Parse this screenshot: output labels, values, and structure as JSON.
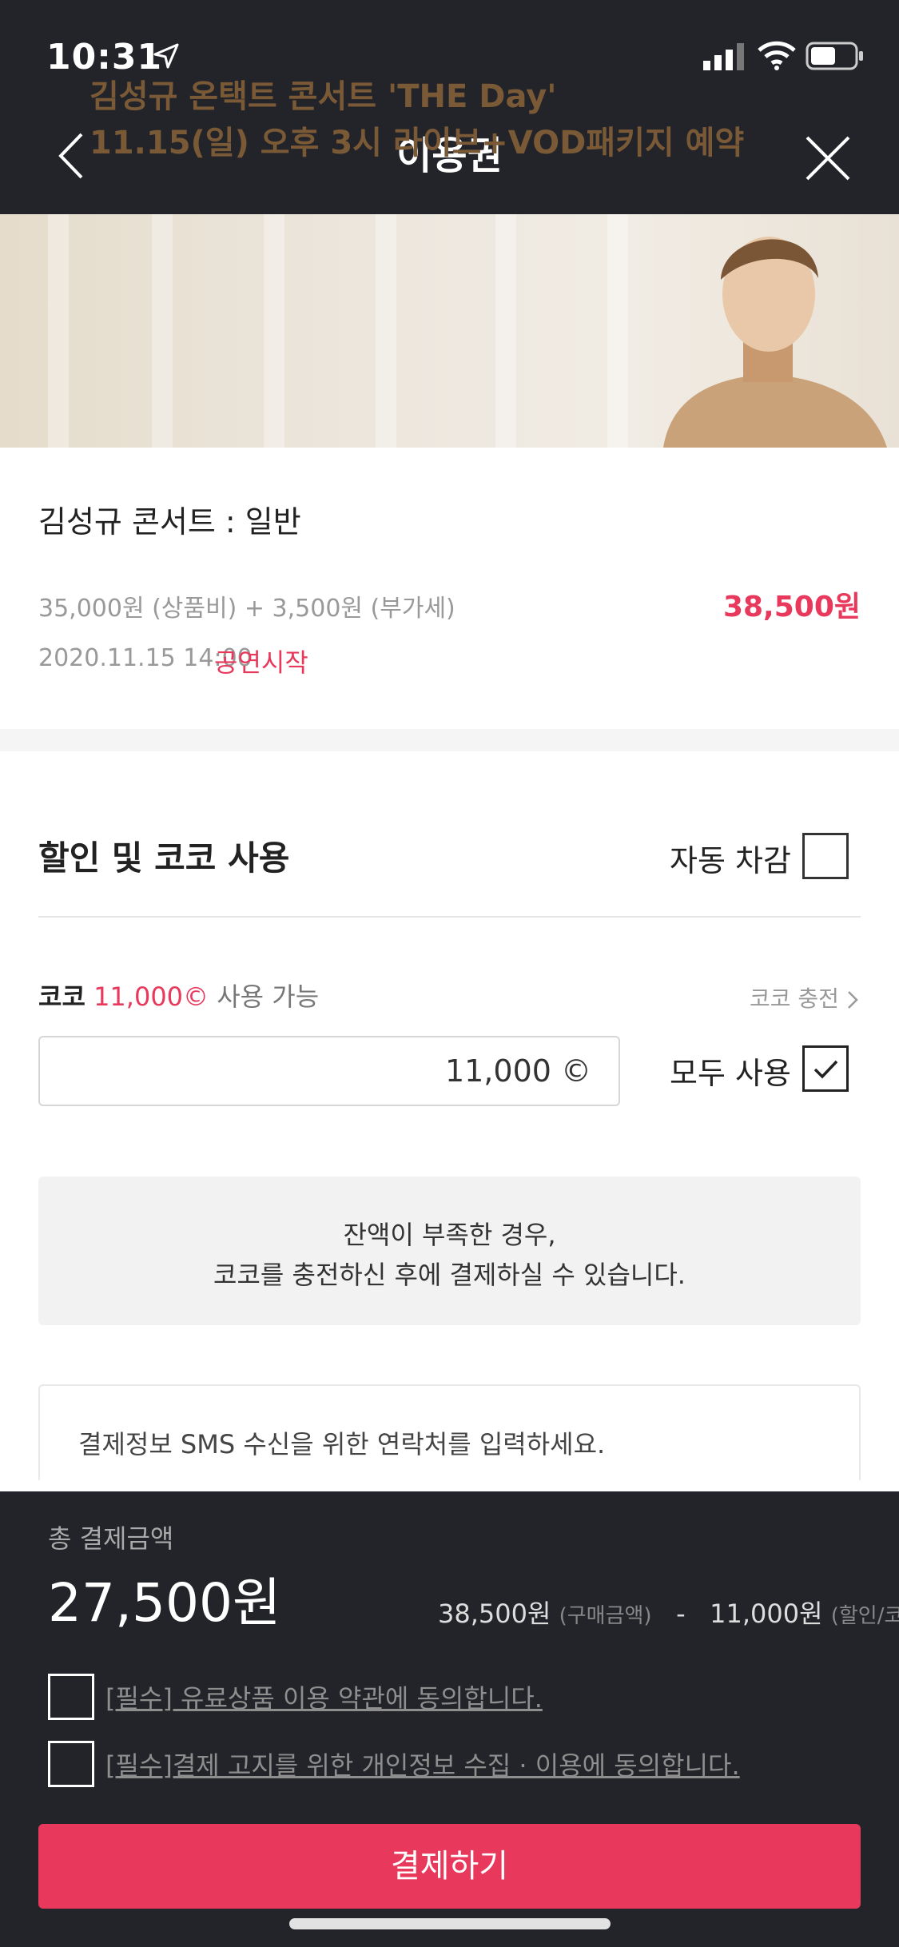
{
  "status_bar": {
    "time": "10:31"
  },
  "header": {
    "title": "이용권"
  },
  "banner": {
    "line1": "김성규 온택트 콘서트 'THE Day'",
    "line2": "11.15(일) 오후 3시 라이브+VOD패키지 예약"
  },
  "product": {
    "name": "김성규 콘서트 : 일반",
    "price_detail": "35,000원 (상품비) + 3,500원 (부가세)",
    "price_total": "38,500원",
    "date": "2020.11.15 14:00",
    "status": "공연시작"
  },
  "discount": {
    "title": "할인 및 코코 사용",
    "auto_label": "자동 차감",
    "coco_label": "코코",
    "coco_amount": "11,000©",
    "coco_available": "사용 가능",
    "coco_charge": "코코 충전",
    "input_value": "11,000 ©",
    "use_all_label": "모두 사용",
    "notice_line1": "잔액이 부족한 경우,",
    "notice_line2": "코코를 충전하신 후에 결제하실 수 있습니다.",
    "sms_prompt": "결제정보 SMS 수신을 위한 연락처를 입력하세요."
  },
  "summary": {
    "total_label": "총 결제금액",
    "total_amount": "27,500원",
    "purchase_amount": "38,500원",
    "purchase_tag": "(구매금액)",
    "minus": "-",
    "discount_amount": "11,000원",
    "discount_tag": "(할인/코코)"
  },
  "agreements": [
    {
      "label": "[필수] 유료상품 이용 약관에 동의합니다."
    },
    {
      "label": "[필수]결제 고지를 위한 개인정보 수집 · 이용에 동의합니다."
    }
  ],
  "pay_button": "결제하기",
  "colors": {
    "accent": "#e8395c",
    "dark": "#23242a"
  }
}
